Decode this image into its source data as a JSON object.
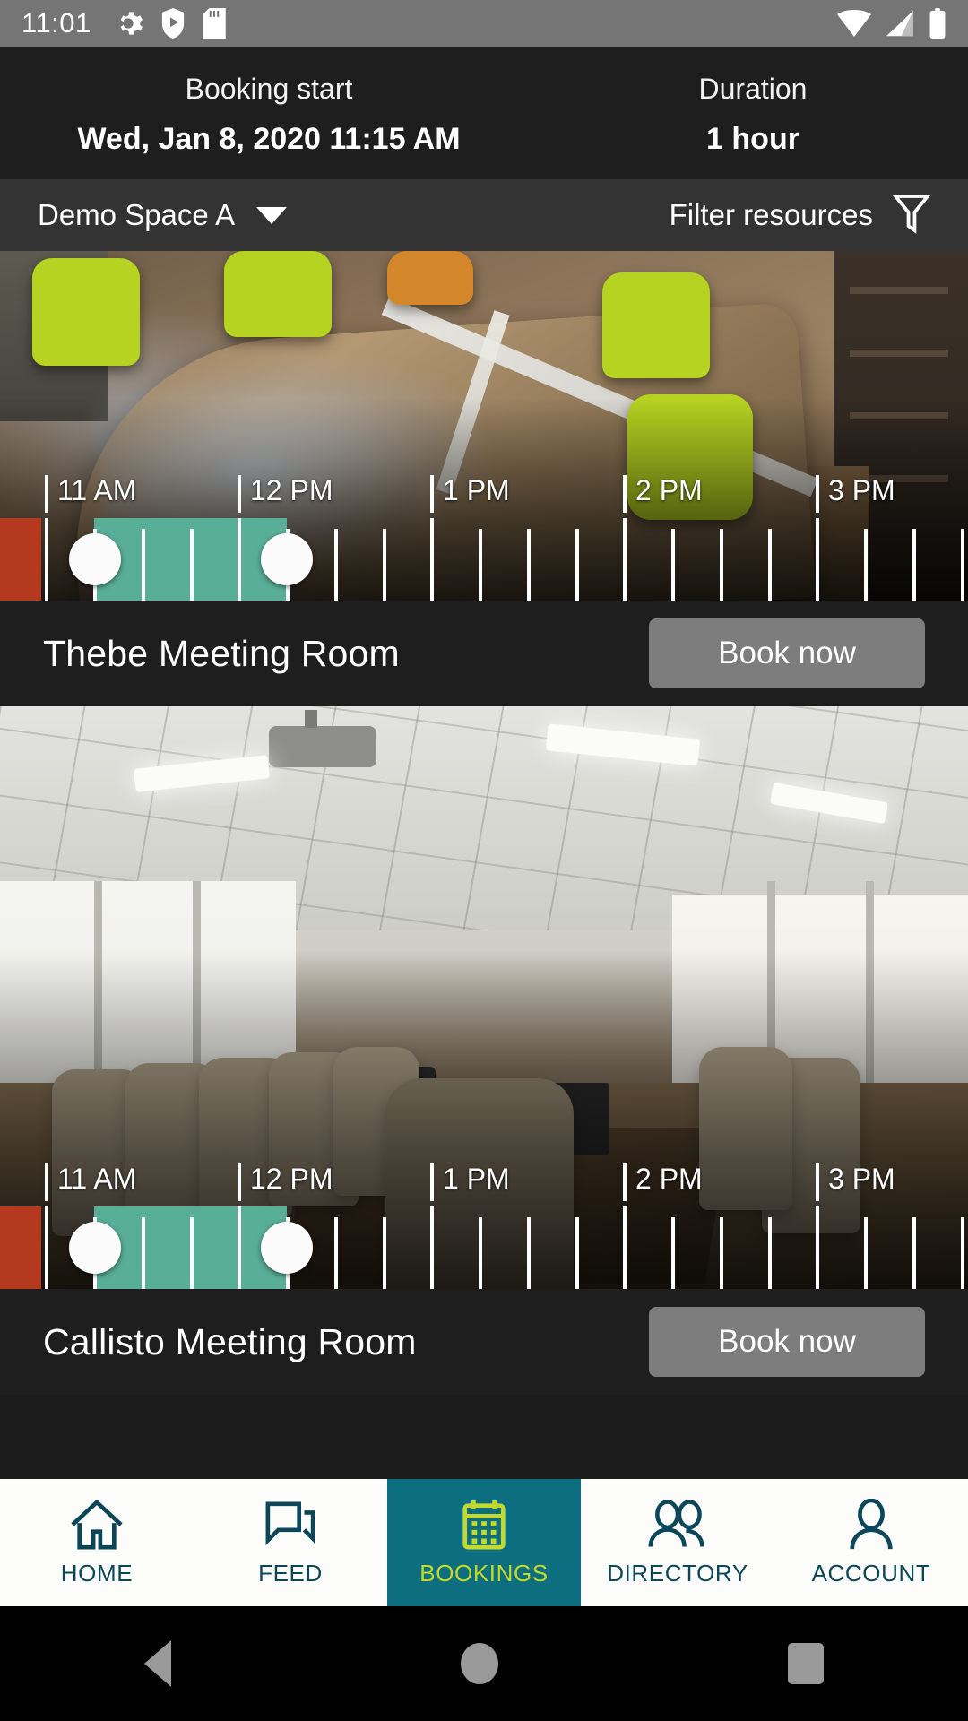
{
  "statusbar": {
    "time": "11:01",
    "left_icons": [
      "gear-icon",
      "shield-play-icon",
      "sd-card-icon"
    ],
    "right_icons": [
      "wifi-icon",
      "signal-icon",
      "battery-icon"
    ]
  },
  "booking_header": {
    "start_label": "Booking start",
    "start_value": "Wed, Jan 8, 2020 11:15 AM",
    "duration_label": "Duration",
    "duration_value": "1 hour"
  },
  "filterbar": {
    "space": "Demo Space A",
    "filter_label": "Filter resources"
  },
  "timeline": {
    "hours": [
      "11 AM",
      "12 PM",
      "1 PM",
      "2 PM",
      "3 PM"
    ],
    "selection_start": "11:15 AM",
    "selection_end": "12:15 PM",
    "busy_color": "#b5391f",
    "selection_color": "#58ae96",
    "handle_color": "#fbfbfb"
  },
  "resources": [
    {
      "name": "Thebe Meeting Room",
      "book_label": "Book now",
      "photo": "conference-room-lime-chairs"
    },
    {
      "name": "Callisto Meeting Room",
      "book_label": "Book now",
      "photo": "boardroom-windows"
    }
  ],
  "bottom_nav": {
    "active_bg": "#0c6e7e",
    "active_fg": "#c4d92e",
    "inactive_fg": "#0b4759",
    "items": [
      {
        "label": "HOME",
        "icon": "home-icon",
        "active": false
      },
      {
        "label": "FEED",
        "icon": "chat-bubbles-icon",
        "active": false
      },
      {
        "label": "BOOKINGS",
        "icon": "calendar-icon",
        "active": true
      },
      {
        "label": "DIRECTORY",
        "icon": "people-icon",
        "active": false
      },
      {
        "label": "ACCOUNT",
        "icon": "person-icon",
        "active": false
      }
    ]
  },
  "system_nav": {
    "back": "back-triangle-icon",
    "home": "home-circle-icon",
    "recents": "recents-square-icon"
  }
}
